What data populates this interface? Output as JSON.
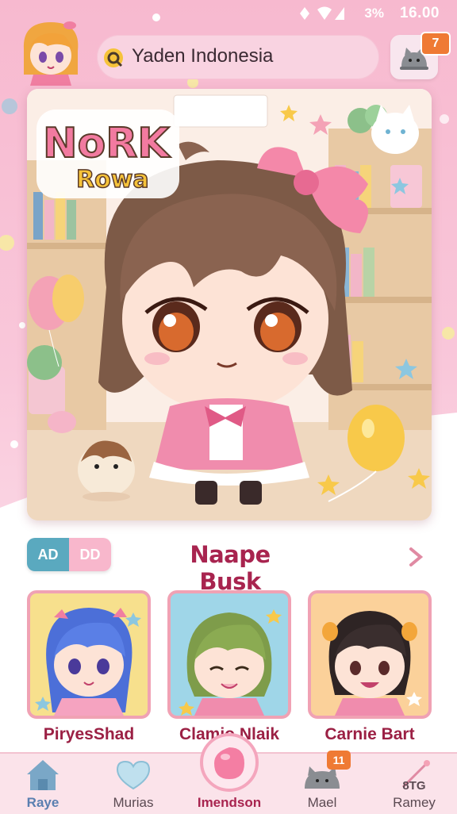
{
  "status_bar": {
    "battery": "3%",
    "time": "16.00"
  },
  "header": {
    "search_text": "Yaden Indonesia",
    "cart_badge": "7"
  },
  "hero": {
    "logo_line1": "NoRK",
    "logo_line2": "Rowa"
  },
  "section": {
    "toggle_left": "AD",
    "toggle_right": "DD",
    "title": "Naape Busk"
  },
  "cards": [
    {
      "name": "PiryesShad",
      "bg": "#f7e08d"
    },
    {
      "name": "Clamio Nlaik",
      "bg": "#9fd6e8"
    },
    {
      "name": "Carnie Bart",
      "bg": "#fbd19a"
    }
  ],
  "nav": {
    "items": [
      {
        "label": "Raye"
      },
      {
        "label": "Murias"
      },
      {
        "label": "Imendson"
      },
      {
        "label": "Mael",
        "badge": "11"
      },
      {
        "label": "Ramey",
        "sublabel": "8TG"
      }
    ]
  },
  "colors": {
    "accent": "#a8244f",
    "pink": "#f7b9cf",
    "badge": "#ef7a34",
    "teal": "#5aa9bf"
  }
}
